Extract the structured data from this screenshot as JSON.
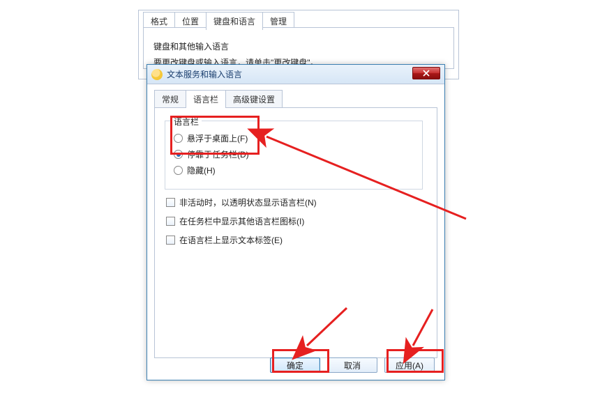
{
  "back": {
    "tabs": {
      "format": "格式",
      "position": "位置",
      "keyboard_lang": "键盘和语言",
      "admin": "管理"
    },
    "heading": "键盘和其他输入语言",
    "subline": "要更改键盘或输入语言，请单击\"更改键盘\"。"
  },
  "dialog": {
    "title": "文本服务和输入语言",
    "tabs": {
      "general": "常规",
      "langbar": "语言栏",
      "advanced": "高级键设置"
    },
    "langbar": {
      "legend": "语言栏",
      "float": "悬浮于桌面上(F)",
      "dock": "停靠于任务栏(D)",
      "hide": "隐藏(H)",
      "inactive_transparent": "非活动时，以透明状态显示语言栏(N)",
      "show_extra_icons": "在任务栏中显示其他语言栏图标(I)",
      "show_text_labels": "在语言栏上显示文本标签(E)"
    },
    "buttons": {
      "ok": "确定",
      "cancel": "取消",
      "apply": "应用(A)"
    }
  }
}
